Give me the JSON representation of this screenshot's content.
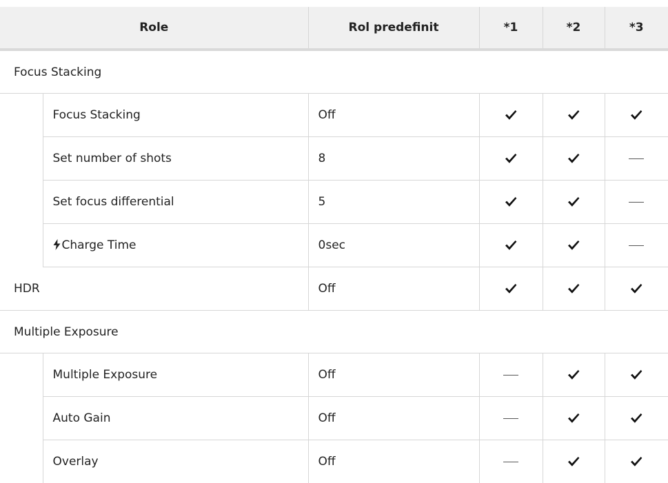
{
  "header": {
    "role": "Role",
    "default_role": "Rol predefinit",
    "col1": "*1",
    "col2": "*2",
    "col3": "*3"
  },
  "sections": {
    "focus_stacking": "Focus Stacking",
    "multiple_exposure": "Multiple Exposure"
  },
  "rows": {
    "fs_focus_stacking": {
      "name": "Focus Stacking",
      "default": "Off",
      "marks": [
        "check",
        "check",
        "check"
      ]
    },
    "fs_shots": {
      "name": "Set number of shots",
      "default": "8",
      "marks": [
        "check",
        "check",
        "dash"
      ]
    },
    "fs_differential": {
      "name": "Set focus differential",
      "default": "5",
      "marks": [
        "check",
        "check",
        "dash"
      ]
    },
    "fs_charge": {
      "name": "Charge Time",
      "icon": "flash-icon",
      "default": "0sec",
      "marks": [
        "check",
        "check",
        "dash"
      ]
    },
    "hdr": {
      "name": "HDR",
      "default": "Off",
      "marks": [
        "check",
        "check",
        "check"
      ]
    },
    "me_multiple": {
      "name": "Multiple Exposure",
      "default": "Off",
      "marks": [
        "dash",
        "check",
        "check"
      ]
    },
    "me_auto_gain": {
      "name": "Auto Gain",
      "default": "Off",
      "marks": [
        "dash",
        "check",
        "check"
      ]
    },
    "me_overlay": {
      "name": "Overlay",
      "default": "Off",
      "marks": [
        "dash",
        "check",
        "check"
      ]
    }
  }
}
